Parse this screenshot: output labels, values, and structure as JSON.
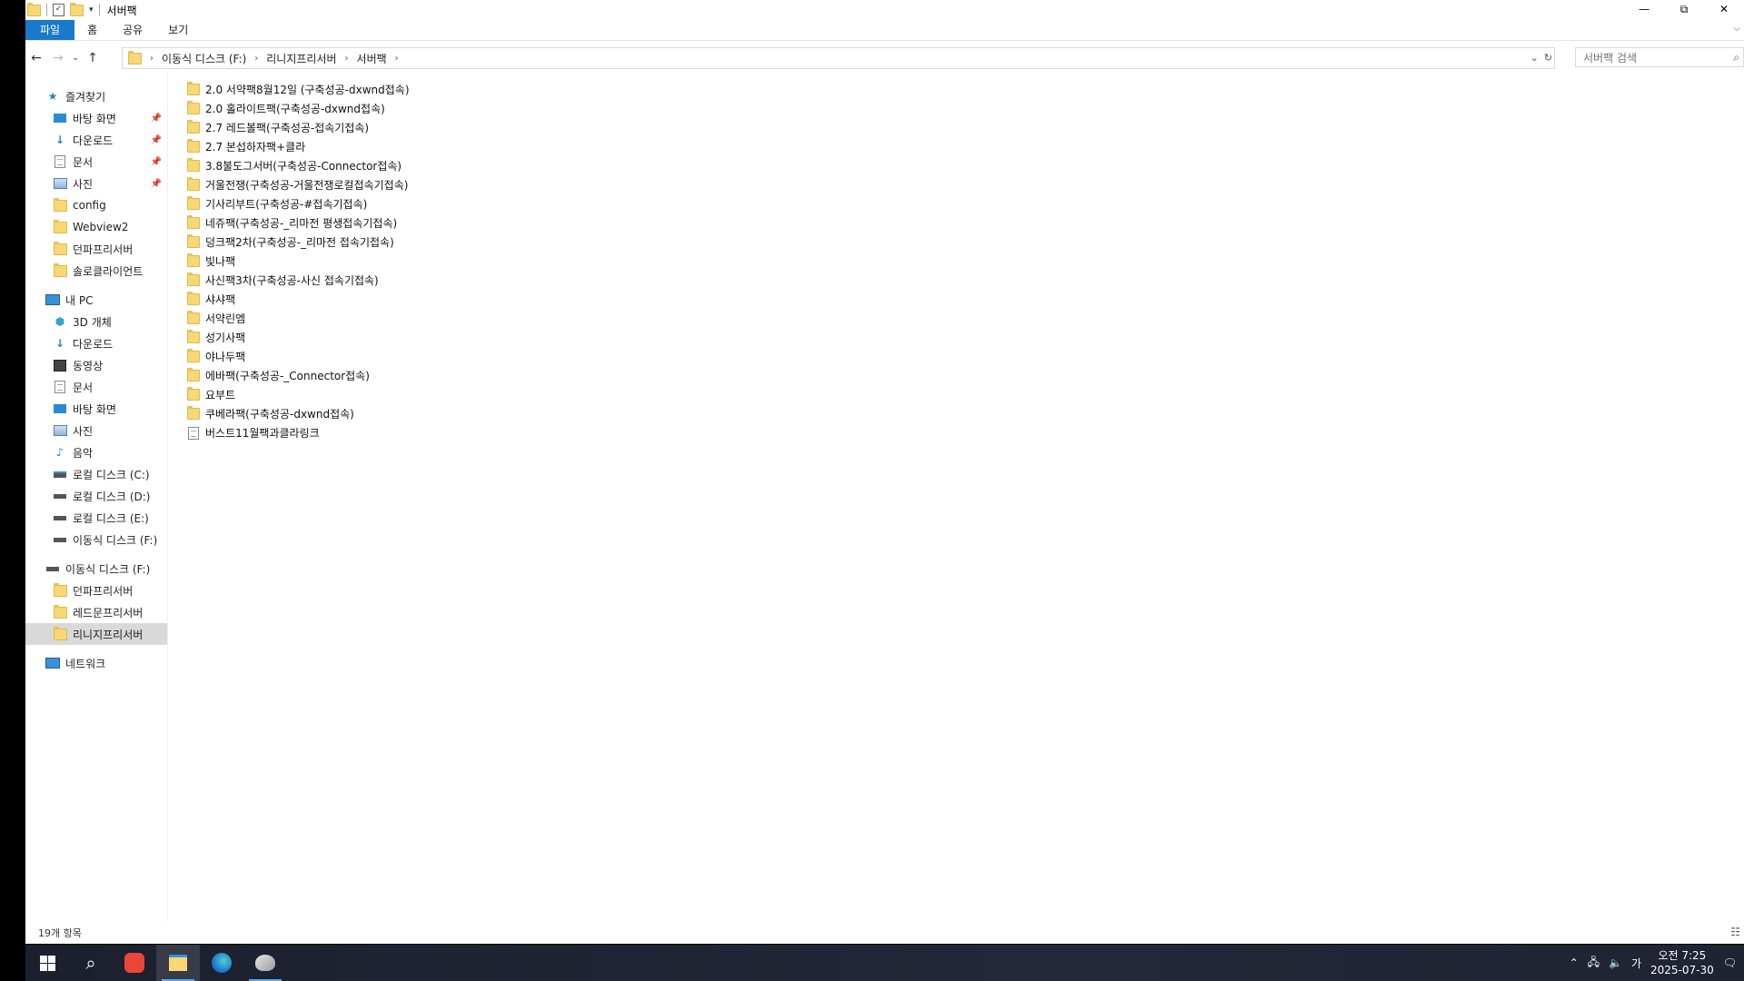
{
  "window": {
    "title": "서버팩",
    "controls": {
      "minimize": "—",
      "maximize": "⧉",
      "close": "✕"
    }
  },
  "ribbon": {
    "tabs": [
      "파일",
      "홈",
      "공유",
      "보기"
    ]
  },
  "address": {
    "crumbs": [
      "이동식 디스크 (F:)",
      "리니지프리서버",
      "서버팩"
    ],
    "search_placeholder": "서버팩 검색"
  },
  "nav": {
    "quick_access": {
      "label": "즐겨찾기",
      "items": [
        {
          "label": "바탕 화면",
          "icon": "desktop-icon",
          "pinned": true
        },
        {
          "label": "다운로드",
          "icon": "download-icon",
          "pinned": true
        },
        {
          "label": "문서",
          "icon": "document-icon",
          "pinned": true
        },
        {
          "label": "사진",
          "icon": "pictures-icon",
          "pinned": true
        },
        {
          "label": "config",
          "icon": "folder-icon",
          "pinned": false
        },
        {
          "label": "Webview2",
          "icon": "folder-icon",
          "pinned": false
        },
        {
          "label": "던파프리서버",
          "icon": "folder-icon",
          "pinned": false
        },
        {
          "label": "솔로클라이언트",
          "icon": "folder-icon",
          "pinned": false
        }
      ]
    },
    "this_pc": {
      "label": "내 PC",
      "items": [
        {
          "label": "3D 개체",
          "icon": "3d-objects-icon"
        },
        {
          "label": "다운로드",
          "icon": "download-icon"
        },
        {
          "label": "동영상",
          "icon": "video-icon"
        },
        {
          "label": "문서",
          "icon": "document-icon"
        },
        {
          "label": "바탕 화면",
          "icon": "desktop-icon"
        },
        {
          "label": "사진",
          "icon": "pictures-icon"
        },
        {
          "label": "음악",
          "icon": "music-icon"
        },
        {
          "label": "로컬 디스크 (C:)",
          "icon": "drive-icon"
        },
        {
          "label": "로컬 디스크 (D:)",
          "icon": "drive-icon"
        },
        {
          "label": "로컬 디스크 (E:)",
          "icon": "drive-icon"
        },
        {
          "label": "이동식 디스크 (F:)",
          "icon": "removable-drive-icon"
        }
      ]
    },
    "removable": {
      "label": "이동식 디스크 (F:)",
      "items": [
        {
          "label": "던파프리서버",
          "icon": "folder-icon",
          "selected": false
        },
        {
          "label": "레드문프리서버",
          "icon": "folder-icon",
          "selected": false
        },
        {
          "label": "리니지프리서버",
          "icon": "folder-icon",
          "selected": true
        }
      ]
    },
    "network": {
      "label": "네트워크"
    }
  },
  "files": [
    {
      "name": "2.0 서약팩8월12일 (구축성공-dxwnd접속)",
      "type": "folder"
    },
    {
      "name": "2.0 홀라이트팩(구축성공-dxwnd접속)",
      "type": "folder"
    },
    {
      "name": "2.7 레드볼팩(구축성공-접속기접속)",
      "type": "folder"
    },
    {
      "name": "2.7 본섭하자팩+클라",
      "type": "folder"
    },
    {
      "name": "3.8불도그서버(구축성공-Connector접속)",
      "type": "folder"
    },
    {
      "name": "거울전쟁(구축성공-거울전쟁로컬접속기접속)",
      "type": "folder"
    },
    {
      "name": "기사리부트(구축성공-#접속기접속)",
      "type": "folder"
    },
    {
      "name": "네쥬팩(구축성공-_리마전 평생접속기접속)",
      "type": "folder"
    },
    {
      "name": "덩크팩2차(구축성공-_리마전 접속기접속)",
      "type": "folder"
    },
    {
      "name": "빛나팩",
      "type": "folder"
    },
    {
      "name": "사신팩3차(구축성공-사신 접속기접속)",
      "type": "folder"
    },
    {
      "name": "샤샤팩",
      "type": "folder"
    },
    {
      "name": "서약린엠",
      "type": "folder"
    },
    {
      "name": "성기사팩",
      "type": "folder"
    },
    {
      "name": "야나두팩",
      "type": "folder"
    },
    {
      "name": "에바팩(구축성공-_Connector접속)",
      "type": "folder"
    },
    {
      "name": "요부트",
      "type": "folder"
    },
    {
      "name": "쿠베라팩(구축성공-dxwnd접속)",
      "type": "folder"
    },
    {
      "name": "버스트11월팩과클라링크",
      "type": "file"
    }
  ],
  "status": {
    "item_count": "19개 항목"
  },
  "taskbar": {
    "apps": [
      {
        "name": "start-button",
        "icon": "windows-logo-icon"
      },
      {
        "name": "search-button",
        "icon": "search-icon"
      },
      {
        "name": "app-red-button",
        "icon": "red-app-icon"
      },
      {
        "name": "file-explorer-button",
        "icon": "file-explorer-icon",
        "active": true
      },
      {
        "name": "edge-button",
        "icon": "edge-icon"
      },
      {
        "name": "paint-app-button",
        "icon": "paint-icon"
      }
    ],
    "tray": {
      "ime": "가",
      "time": "오전 7:25",
      "date": "2025-07-30"
    }
  },
  "colors": {
    "accent": "#1979ca",
    "folder": "#f8d775",
    "selection": "#d9d9d9",
    "taskbar": "#1b1f2e"
  }
}
